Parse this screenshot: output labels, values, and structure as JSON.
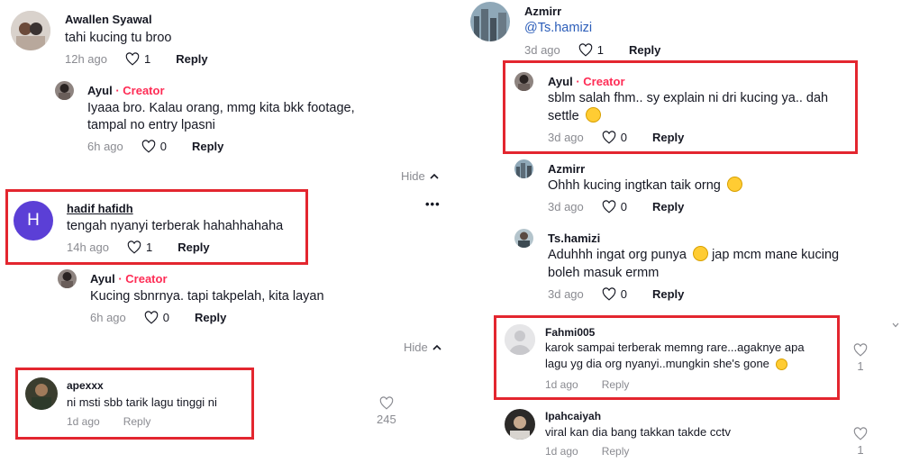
{
  "left": {
    "c1": {
      "name": "Awallen Syawal",
      "text": "tahi kucing tu broo",
      "time": "12h ago",
      "likes": "1",
      "reply": "Reply"
    },
    "r1": {
      "name": "Ayul",
      "badge": "· Creator",
      "line1": "Iyaaa bro. Kalau orang, mmg kita bkk footage,",
      "line2": "tampal no entry lpasni",
      "time": "6h ago",
      "likes": "0",
      "reply": "Reply"
    },
    "hide1": "Hide",
    "c2": {
      "avatar_letter": "H",
      "name": "hadif hafidh",
      "text": "tengah nyanyi terberak hahahhahaha",
      "time": "14h ago",
      "likes": "1",
      "reply": "Reply",
      "more": "•••"
    },
    "r2": {
      "name": "Ayul",
      "badge": "· Creator",
      "text": "Kucing sbnrnya. tapi takpelah, kita layan",
      "time": "6h ago",
      "likes": "0",
      "reply": "Reply"
    },
    "hide2": "Hide",
    "c3": {
      "name": "apexxx",
      "text": "ni msti sbb tarik lagu tinggi ni",
      "time": "1d ago",
      "reply": "Reply",
      "likes": "245"
    }
  },
  "right": {
    "c1": {
      "name": "Azmirr",
      "text": "@Ts.hamizi",
      "time": "3d ago",
      "likes": "1",
      "reply": "Reply"
    },
    "r1": {
      "name": "Ayul",
      "badge": "· Creator",
      "line1": "sblm salah fhm.. sy explain ni dri kucing ya.. dah",
      "line2": "settle",
      "time": "3d ago",
      "likes": "0",
      "reply": "Reply"
    },
    "r2": {
      "name": "Azmirr",
      "text": "Ohhh kucing ingtkan taik orng",
      "time": "3d ago",
      "likes": "0",
      "reply": "Reply"
    },
    "r3": {
      "name": "Ts.hamizi",
      "line1a": "Aduhhh ingat org punya",
      "line1b": "jap mcm mane kucing",
      "line2": "boleh masuk ermm",
      "time": "3d ago",
      "likes": "0",
      "reply": "Reply"
    },
    "c2": {
      "name": "Fahmi005",
      "line1": "karok sampai terberak memng rare...agaknye apa",
      "line2": "lagu yg dia org nyanyi..mungkin she's gone",
      "time": "1d ago",
      "reply": "Reply",
      "likes": "1"
    },
    "c3": {
      "name": "Ipahcaiyah",
      "text": "viral kan dia bang takkan takde cctv",
      "time": "1d ago",
      "reply": "Reply",
      "likes": "1"
    }
  },
  "colors": {
    "creator": "#fe2c55",
    "highlight_box": "#e3262f",
    "mention": "#2b5db9",
    "avatar_h": "#5b3fd6"
  }
}
